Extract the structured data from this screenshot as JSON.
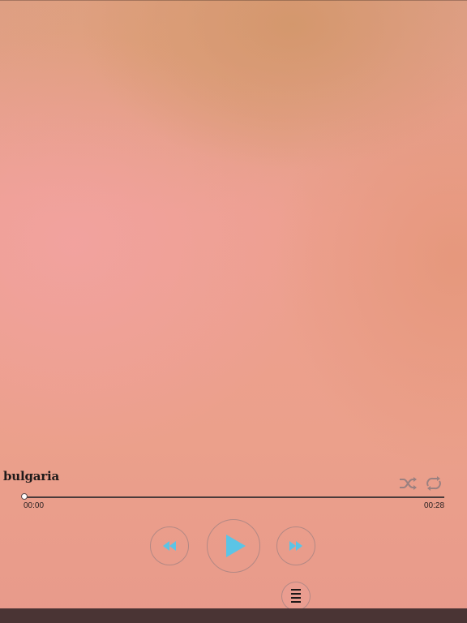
{
  "track": {
    "title": "bulgaria"
  },
  "playback": {
    "elapsed": "00:00",
    "total": "00:28",
    "progress_fraction": 0.0
  },
  "controls": {
    "shuffle_icon": "shuffle-icon",
    "repeat_icon": "repeat-icon",
    "rewind_icon": "rewind-icon",
    "play_icon": "play-icon",
    "forward_icon": "fast-forward-icon",
    "playlist_icon": "list-icon"
  },
  "colors": {
    "accent": "#5bc4e6",
    "ring": "#a08282",
    "bottom_bar": "#4a3434"
  }
}
